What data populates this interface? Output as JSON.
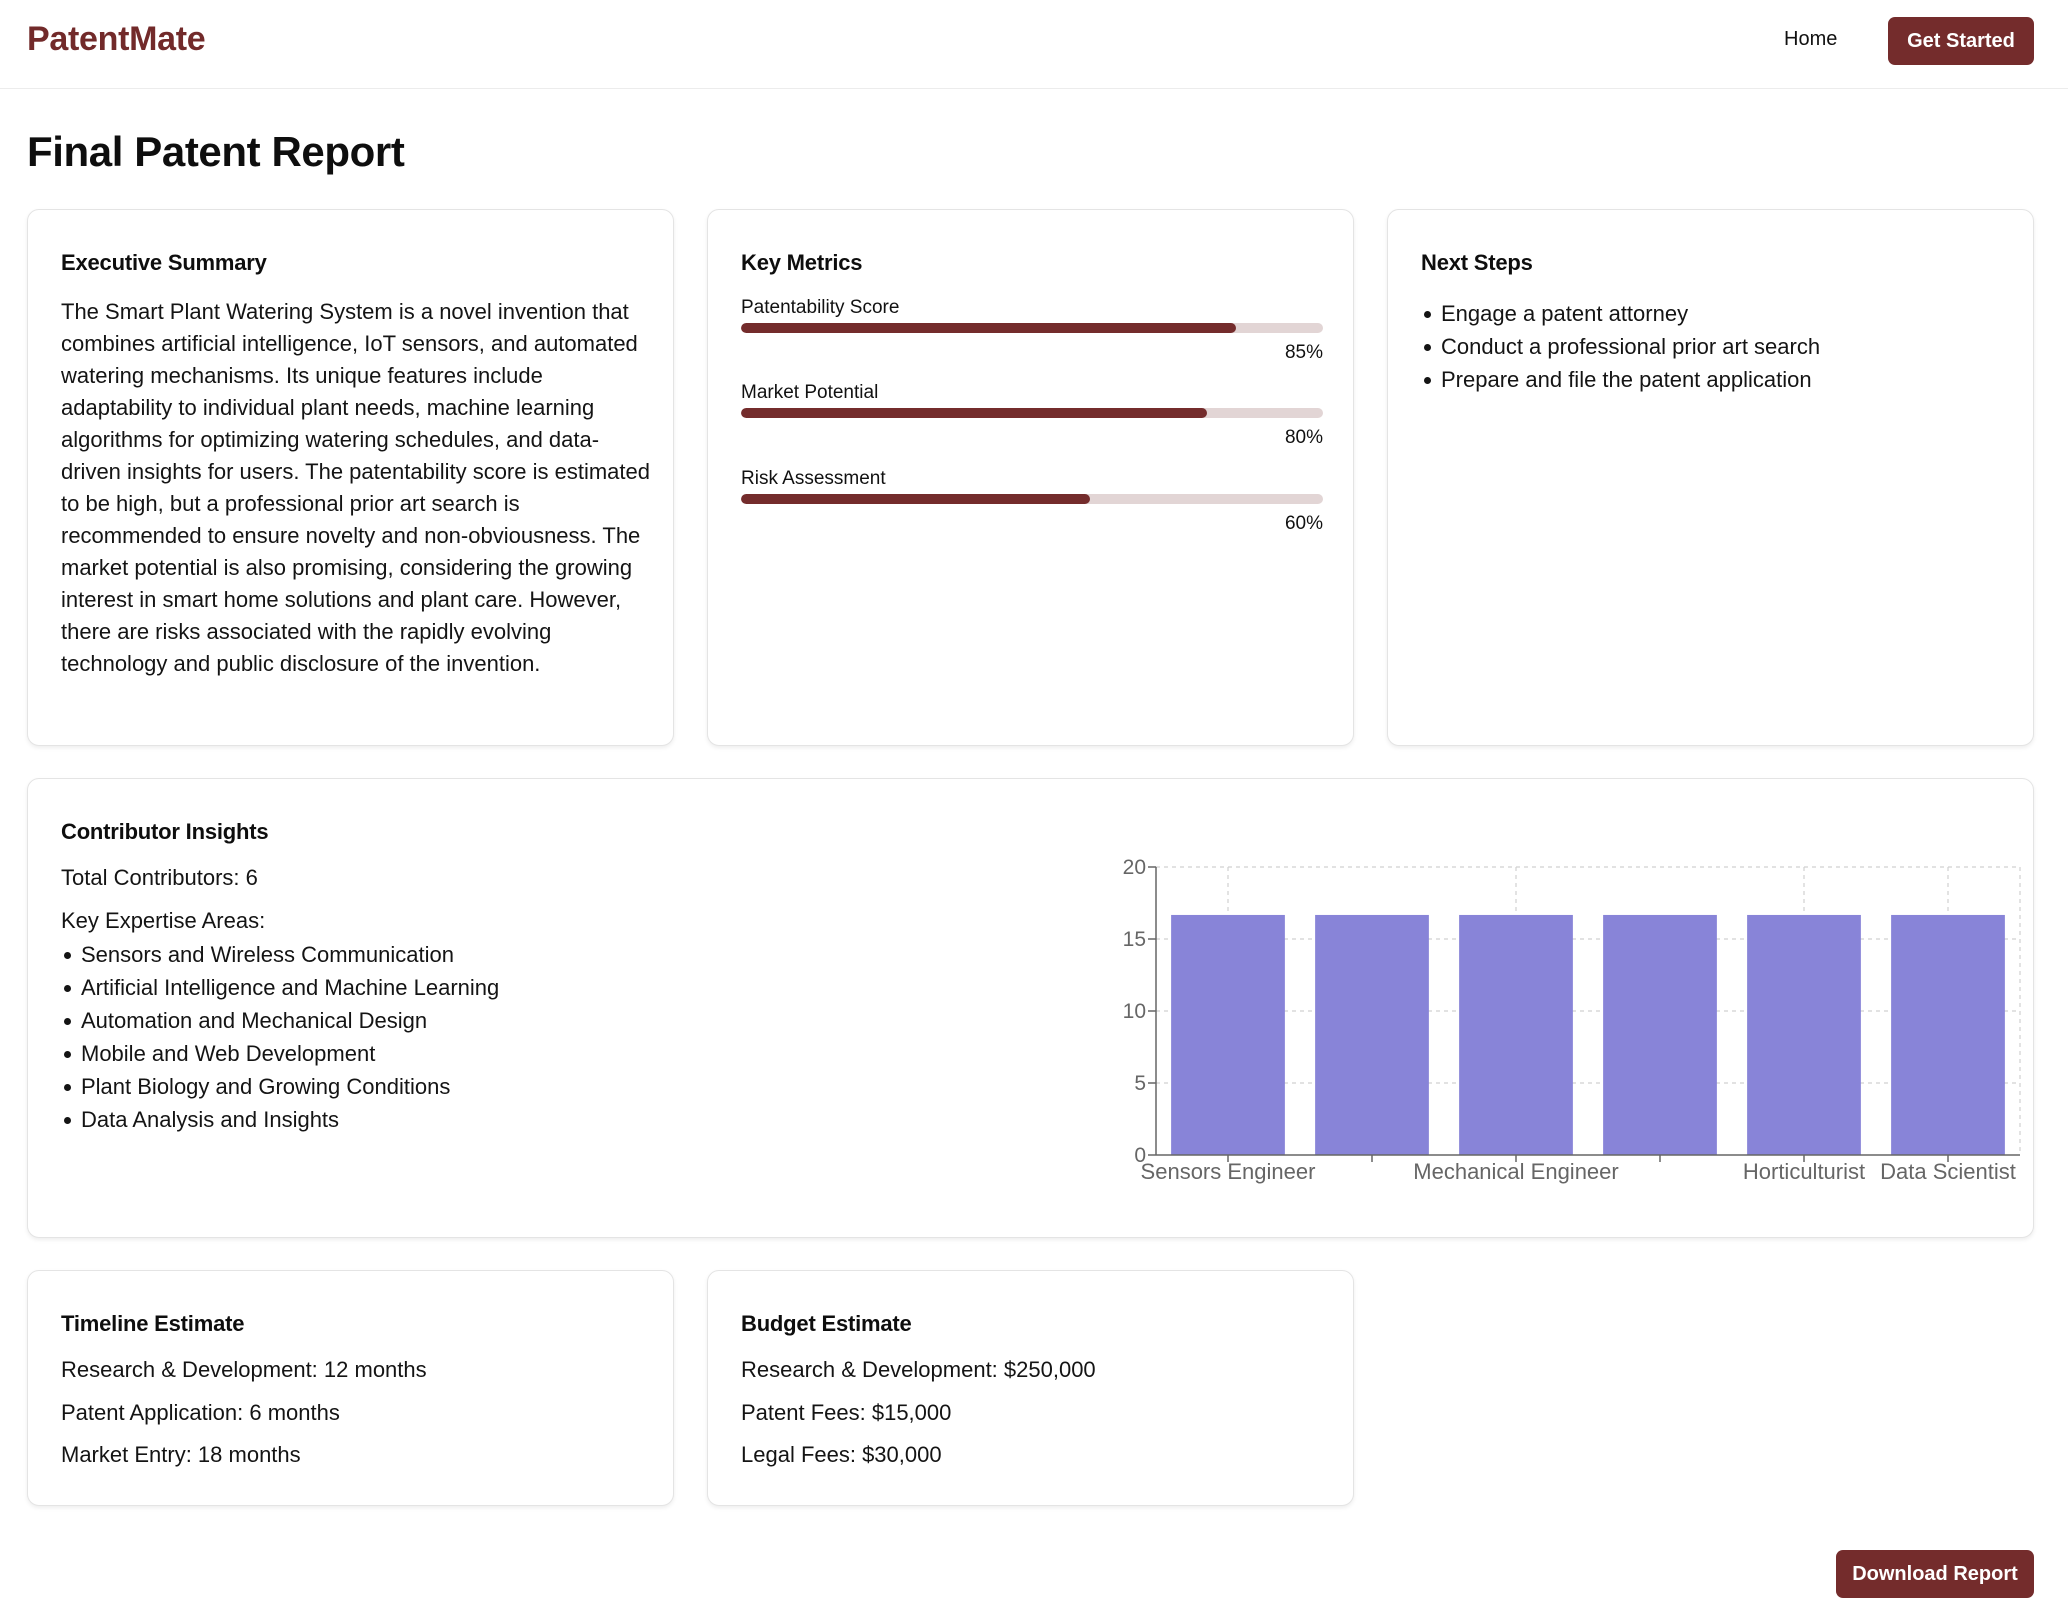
{
  "header": {
    "brand": "PatentMate",
    "nav_home": "Home",
    "cta": "Get Started"
  },
  "page_title": "Final Patent Report",
  "summary": {
    "title": "Executive Summary",
    "text": "The Smart Plant Watering System is a novel invention that combines artificial intelligence, IoT sensors, and automated watering mechanisms. Its unique features include adaptability to individual plant needs, machine learning algorithms for optimizing watering schedules, and data-driven insights for users. The patentability score is estimated to be high, but a professional prior art search is recommended to ensure novelty and non-obviousness. The market potential is also promising, considering the growing interest in smart home solutions and plant care. However, there are risks associated with the rapidly evolving technology and public disclosure of the invention."
  },
  "metrics": {
    "title": "Key Metrics",
    "items": [
      {
        "label": "Patentability Score",
        "value": 85,
        "display": "85%"
      },
      {
        "label": "Market Potential",
        "value": 80,
        "display": "80%"
      },
      {
        "label": "Risk Assessment",
        "value": 60,
        "display": "60%"
      }
    ]
  },
  "next_steps": {
    "title": "Next Steps",
    "items": [
      "Engage a patent attorney",
      "Conduct a professional prior art search",
      "Prepare and file the patent application"
    ]
  },
  "contributors": {
    "title": "Contributor Insights",
    "total": "Total Contributors: 6",
    "key_label": "Key Expertise Areas:",
    "areas": [
      "Sensors and Wireless Communication",
      "Artificial Intelligence and Machine Learning",
      "Automation and Mechanical Design",
      "Mobile and Web Development",
      "Plant Biology and Growing Conditions",
      "Data Analysis and Insights"
    ]
  },
  "chart_data": {
    "type": "bar",
    "categories": [
      "Sensors Engineer",
      "",
      "Mechanical Engineer",
      "",
      "Horticulturist",
      "Data Scientist"
    ],
    "values": [
      16.67,
      16.67,
      16.67,
      16.67,
      16.67,
      16.67
    ],
    "ylim": [
      0,
      20
    ],
    "yticks": [
      0,
      5,
      10,
      15,
      20
    ],
    "grid": true,
    "bar_color": "#8884d8"
  },
  "timeline": {
    "title": "Timeline Estimate",
    "items": [
      "Research & Development: 12 months",
      "Patent Application: 6 months",
      "Market Entry: 18 months"
    ]
  },
  "budget": {
    "title": "Budget Estimate",
    "items": [
      "Research & Development: $250,000",
      "Patent Fees: $15,000",
      "Legal Fees: $30,000"
    ]
  },
  "download_label": "Download Report",
  "colors": {
    "brand": "#722a2a",
    "button": "#742c2c",
    "bar_track": "#e2d5d5",
    "chart_bar": "#8884d8"
  }
}
